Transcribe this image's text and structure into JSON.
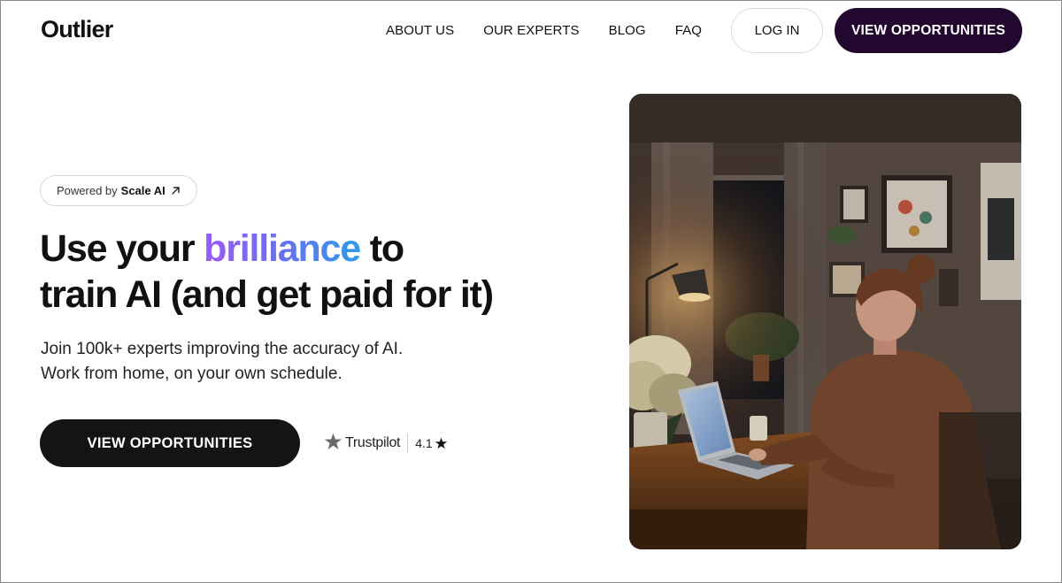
{
  "header": {
    "logo": "Outlier",
    "nav": [
      "ABOUT US",
      "OUR EXPERTS",
      "BLOG",
      "FAQ"
    ],
    "login_label": "LOG IN",
    "cta_label": "VIEW OPPORTUNITIES"
  },
  "hero": {
    "powered_prefix": "Powered by",
    "powered_brand": "Scale AI",
    "powered_icon": "arrow-up-right-icon",
    "headline_part1": "Use your ",
    "headline_highlight": "brilliance",
    "headline_part2": " to",
    "headline_line2": "train AI (and get paid for it)",
    "sub_line1": "Join 100k+ experts improving the accuracy of AI.",
    "sub_line2": "Work from home, on your own schedule.",
    "cta_label": "VIEW OPPORTUNITIES",
    "trust_brand": "Trustpilot",
    "trust_rating": "4.1",
    "trust_icon": "star-icon",
    "image_subject": "woman-working-on-laptop-at-night"
  },
  "colors": {
    "header_cta_bg": "#22082f",
    "hero_cta_bg": "#141414",
    "gradient_start": "#9b5cf4",
    "gradient_end": "#2f9be8"
  }
}
